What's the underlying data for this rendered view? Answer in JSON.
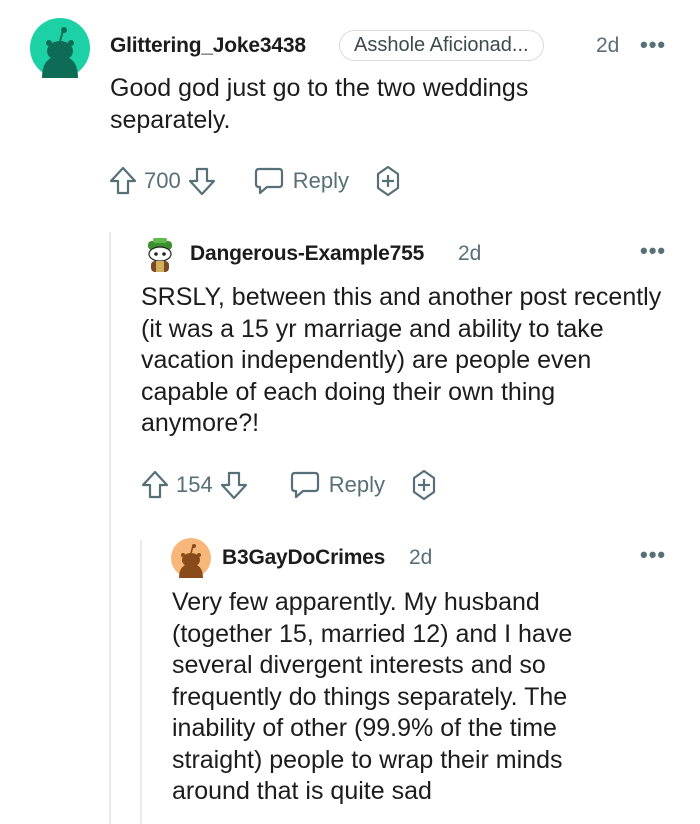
{
  "comments": [
    {
      "username": "Glittering_Joke3438",
      "flair": "Asshole Aficionad...",
      "time": "2d",
      "text": "Good god just go to the two weddings separately.",
      "votes": "700",
      "reply_label": "Reply",
      "avatar_color": "#1bd1a5"
    },
    {
      "username": "Dangerous-Example755",
      "time": "2d",
      "text": "SRSLY, between this and another post recently (it was a 15 yr marriage and ability to take vacation independently) are people even capable of each doing their own thing anymore?!",
      "votes": "154",
      "reply_label": "Reply"
    },
    {
      "username": "B3GayDoCrimes",
      "time": "2d",
      "text": "Very few apparently. My husband (together 15, married 12) and I have several divergent interests and so frequently do things separately. The inability of other (99.9% of the time straight) people to wrap their minds around that is quite sad",
      "avatar_color": "#f7b77a"
    }
  ],
  "more_options_glyph": "•••"
}
